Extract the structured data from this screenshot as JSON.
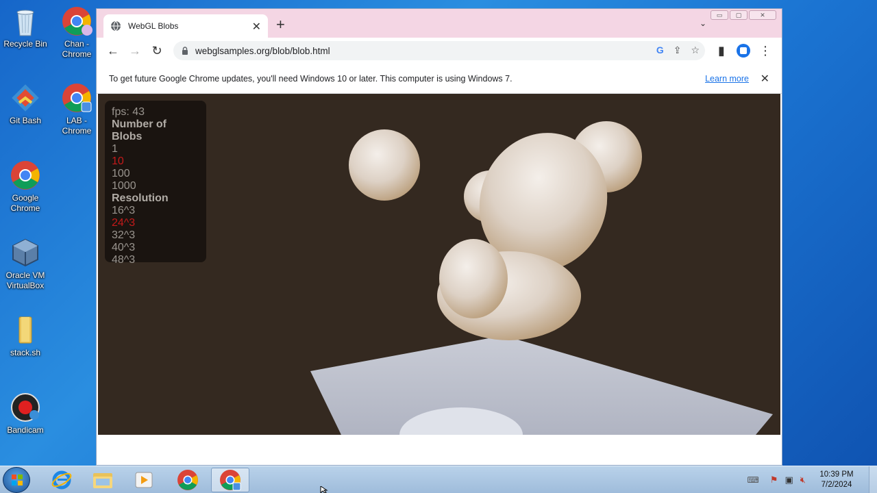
{
  "desktop": {
    "icons": [
      {
        "label": "Recycle Bin",
        "icon": "recycle-bin-icon"
      },
      {
        "label": "Chan - Chrome",
        "icon": "chrome-shortcut-icon"
      },
      {
        "label": "Git Bash",
        "icon": "git-bash-icon"
      },
      {
        "label": "LAB - Chrome",
        "icon": "chrome-shortcut-icon"
      },
      {
        "label": "Google Chrome",
        "icon": "chrome-icon"
      },
      {
        "label": "Oracle VM VirtualBox",
        "icon": "virtualbox-icon"
      },
      {
        "label": "stack.sh",
        "icon": "folder-icon"
      },
      {
        "label": "Bandicam",
        "icon": "bandicam-icon"
      }
    ]
  },
  "browser": {
    "tab_title": "WebGL Blobs",
    "url": "webglsamples.org/blob/blob.html",
    "infobar_text": "To get future Google Chrome updates, you'll need Windows 10 or later. This computer is using Windows 7.",
    "infobar_link": "Learn more",
    "accent": "#1a73e8",
    "tabstrip_color": "#f4d6e4"
  },
  "demo": {
    "fps": "fps: 43",
    "blobs_header": "Number of Blobs",
    "blob_options": [
      "1",
      "10",
      "100",
      "1000"
    ],
    "blob_selected": "10",
    "resolution_header": "Resolution",
    "resolution_options": [
      "16^3",
      "24^3",
      "32^3",
      "40^3",
      "48^3"
    ],
    "resolution_selected": "24^3",
    "selected_color": "#c41a1a"
  },
  "taskbar": {
    "time": "10:39 PM",
    "date": "7/2/2024"
  }
}
